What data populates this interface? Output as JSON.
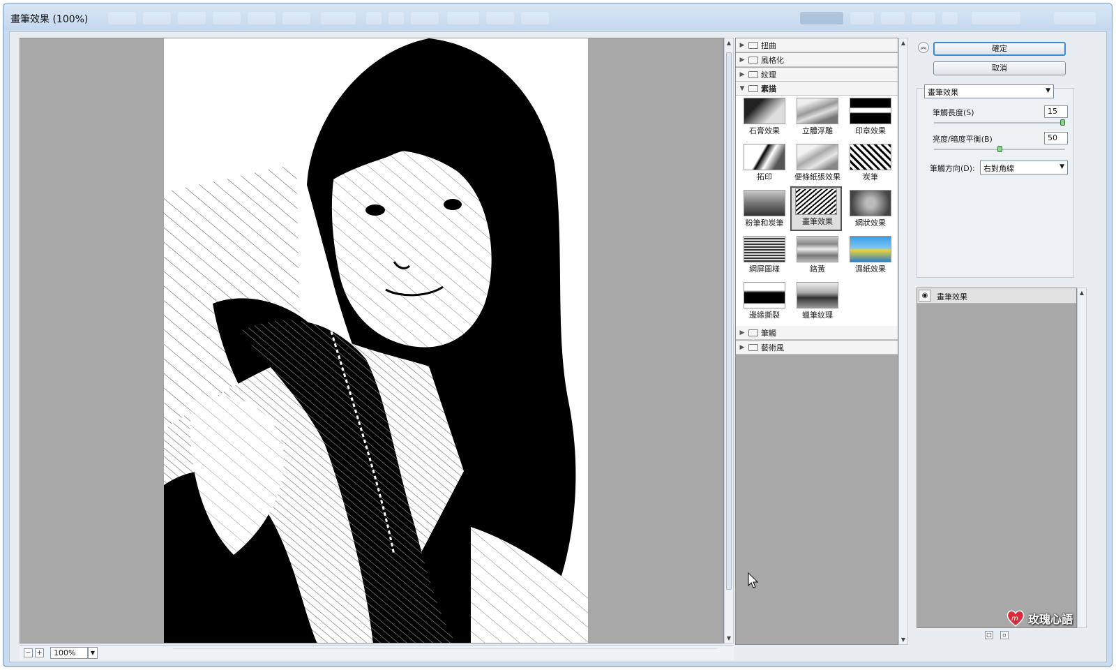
{
  "window": {
    "title": "畫筆效果 (100%)"
  },
  "preview": {
    "zoom_out_label": "−",
    "zoom_in_label": "+",
    "zoom_value": "100%"
  },
  "gallery": {
    "categories_top": [
      {
        "label": "扭曲",
        "expanded": false
      },
      {
        "label": "風格化",
        "expanded": false
      },
      {
        "label": "紋理",
        "expanded": false
      },
      {
        "label": "素描",
        "expanded": true
      }
    ],
    "thumbnails": [
      {
        "label": "石膏效果"
      },
      {
        "label": "立體浮雕"
      },
      {
        "label": "印章效果"
      },
      {
        "label": "拓印"
      },
      {
        "label": "便條紙張效果"
      },
      {
        "label": "炭筆"
      },
      {
        "label": "粉筆和炭筆"
      },
      {
        "label": "畫筆效果",
        "selected": true
      },
      {
        "label": "網狀效果"
      },
      {
        "label": "網屏圖樣"
      },
      {
        "label": "鉻黃"
      },
      {
        "label": "濕紙效果"
      },
      {
        "label": "邊緣撕裂"
      },
      {
        "label": "蠟筆紋理"
      }
    ],
    "categories_bottom": [
      {
        "label": "筆觸",
        "expanded": false
      },
      {
        "label": "藝術風",
        "expanded": false
      }
    ]
  },
  "options": {
    "ok_label": "確定",
    "cancel_label": "取消",
    "filter_select": "畫筆效果",
    "stroke_length_label": "筆觸長度(S)",
    "stroke_length_value": "15",
    "stroke_length_fraction": 1.0,
    "balance_label": "亮度/暗度平衡(B)",
    "balance_value": "50",
    "balance_fraction": 0.5,
    "direction_label": "筆觸方向(D):",
    "direction_value": "右對角線"
  },
  "layers": {
    "items": [
      {
        "label": "畫筆效果"
      }
    ]
  },
  "watermark": {
    "text": "玫瑰心語"
  },
  "colors": {
    "accent": "#3a8ad0",
    "panel_gray": "#a8a8a8",
    "slider_knob": "#8cd08c"
  }
}
